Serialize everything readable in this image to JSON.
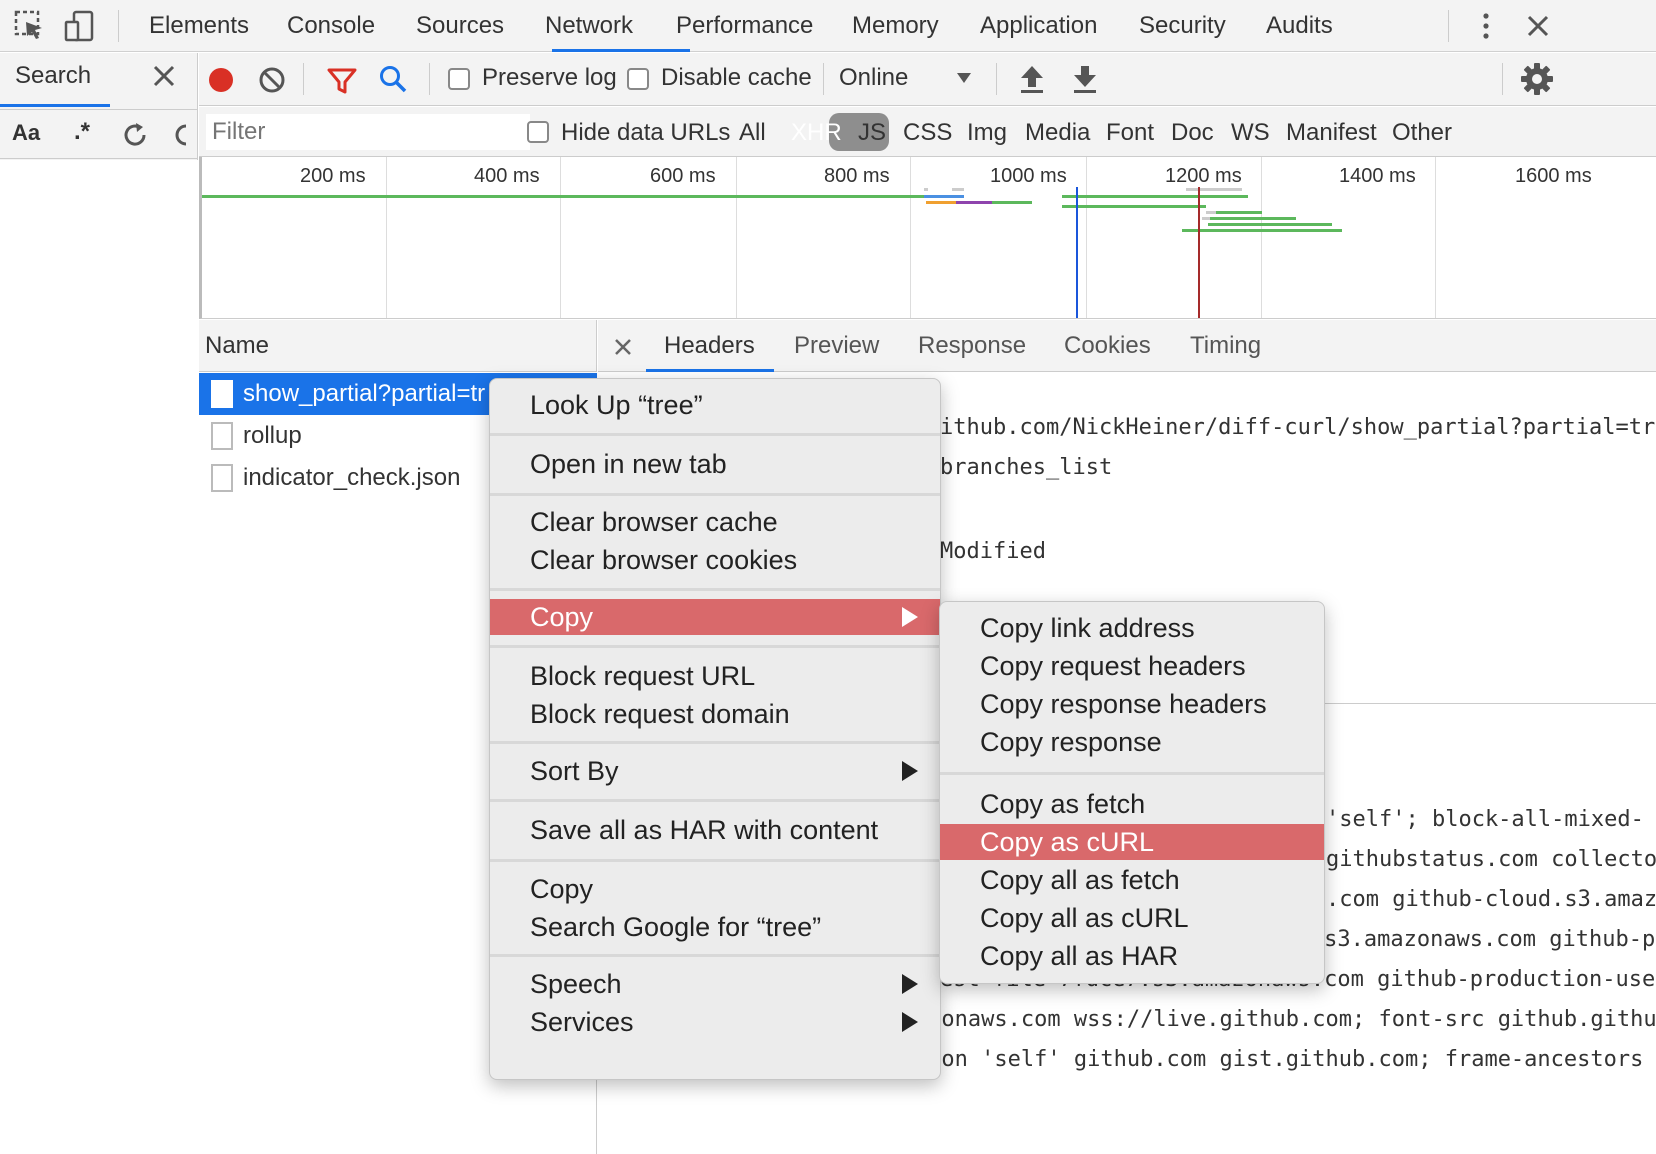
{
  "devtools": {
    "tabs": [
      {
        "label": "Elements"
      },
      {
        "label": "Console"
      },
      {
        "label": "Sources"
      },
      {
        "label": "Network"
      },
      {
        "label": "Performance"
      },
      {
        "label": "Memory"
      },
      {
        "label": "Application"
      },
      {
        "label": "Security"
      },
      {
        "label": "Audits"
      }
    ],
    "active_tab": "Network",
    "accent_color": "#1a73e8"
  },
  "search_panel": {
    "title": "Search",
    "match_case_label": "Aa",
    "regex_label": ".*"
  },
  "toolbar": {
    "preserve_log_label": "Preserve log",
    "disable_cache_label": "Disable cache",
    "throttling_value": "Online",
    "record_color": "#d93025"
  },
  "filter": {
    "placeholder": "Filter",
    "hide_data_urls_label": "Hide data URLs",
    "types": [
      "All",
      "XHR",
      "JS",
      "CSS",
      "Img",
      "Media",
      "Font",
      "Doc",
      "WS",
      "Manifest",
      "Other"
    ],
    "active_type": "XHR"
  },
  "timeline": {
    "ticks": [
      "200 ms",
      "400 ms",
      "600 ms",
      "800 ms",
      "1000 ms",
      "1200 ms",
      "1400 ms",
      "1600 ms"
    ]
  },
  "requests": {
    "header": "Name",
    "items": [
      {
        "name": "show_partial?partial=tr"
      },
      {
        "name": "rollup"
      },
      {
        "name": "indicator_check.json"
      }
    ]
  },
  "detail": {
    "tabs": [
      {
        "label": "Headers"
      },
      {
        "label": "Preview"
      },
      {
        "label": "Response"
      },
      {
        "label": "Cookies"
      },
      {
        "label": "Timing"
      }
    ],
    "active_tab": "Headers",
    "lines": [
      "ithub.com/NickHeiner/diff-curl/show_partial?partial=tr",
      "branches_list",
      "Modified",
      "'self'; block-all-mixed-",
      "githubstatus.com collecto",
      ".com github-cloud.s3.amaz",
      "ction-repository-file-5c1aeb.s3.amazonaws.com github-p",
      "est-file-7fdce7.s3.amazonaws.com github-production-use",
      "r-asset-6210df.s3.amazonaws.com wss://live.github.com; font-src github.githu",
      "bassets.com; form-action 'self' github.com gist.github.com; frame-ancestors"
    ]
  },
  "context_menu": {
    "items": {
      "look_up": "Look Up “tree”",
      "open_new_tab": "Open in new tab",
      "clear_cache": "Clear browser cache",
      "clear_cookies": "Clear browser cookies",
      "copy": "Copy",
      "block_url": "Block request URL",
      "block_domain": "Block request domain",
      "sort_by": "Sort By",
      "save_har": "Save all as HAR with content",
      "copy_plain": "Copy",
      "search_google": "Search Google for “tree”",
      "speech": "Speech",
      "services": "Services"
    },
    "highlight_color": "#d9696b"
  },
  "copy_submenu": {
    "items": {
      "copy_link": "Copy link address",
      "copy_req_headers": "Copy request headers",
      "copy_resp_headers": "Copy response headers",
      "copy_response": "Copy response",
      "copy_fetch": "Copy as fetch",
      "copy_curl": "Copy as cURL",
      "copy_all_fetch": "Copy all as fetch",
      "copy_all_curl": "Copy all as cURL",
      "copy_all_har": "Copy all as HAR"
    },
    "selected": "Copy as cURL"
  }
}
